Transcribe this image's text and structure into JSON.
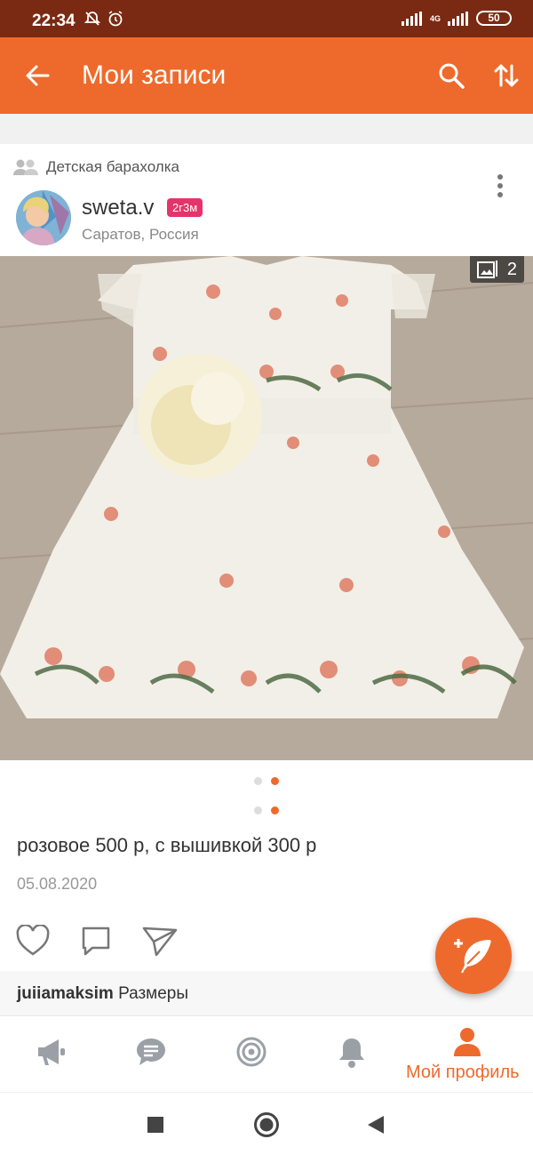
{
  "status_bar": {
    "time": "22:34",
    "battery": "50",
    "network": "4G"
  },
  "app_bar": {
    "title": "Мои записи"
  },
  "post": {
    "group": "Детская барахолка",
    "author": "sweta.v",
    "age_badge": "2г3м",
    "location": "Саратов, Россия",
    "photo_count": "2",
    "text": "розовое 500 р, с вышивкой 300 р",
    "date": "05.08.2020",
    "comment": {
      "author": "juiiamaksim",
      "text": "Размеры"
    }
  },
  "bottom_nav": {
    "items": [
      {
        "name": "feed"
      },
      {
        "name": "messages"
      },
      {
        "name": "discussions"
      },
      {
        "name": "notifications"
      },
      {
        "name": "profile",
        "label": "Мой профиль",
        "active": true
      }
    ]
  },
  "colors": {
    "accent": "#ee6a2c",
    "status_bar": "#7a2a12",
    "badge": "#e5336b"
  }
}
